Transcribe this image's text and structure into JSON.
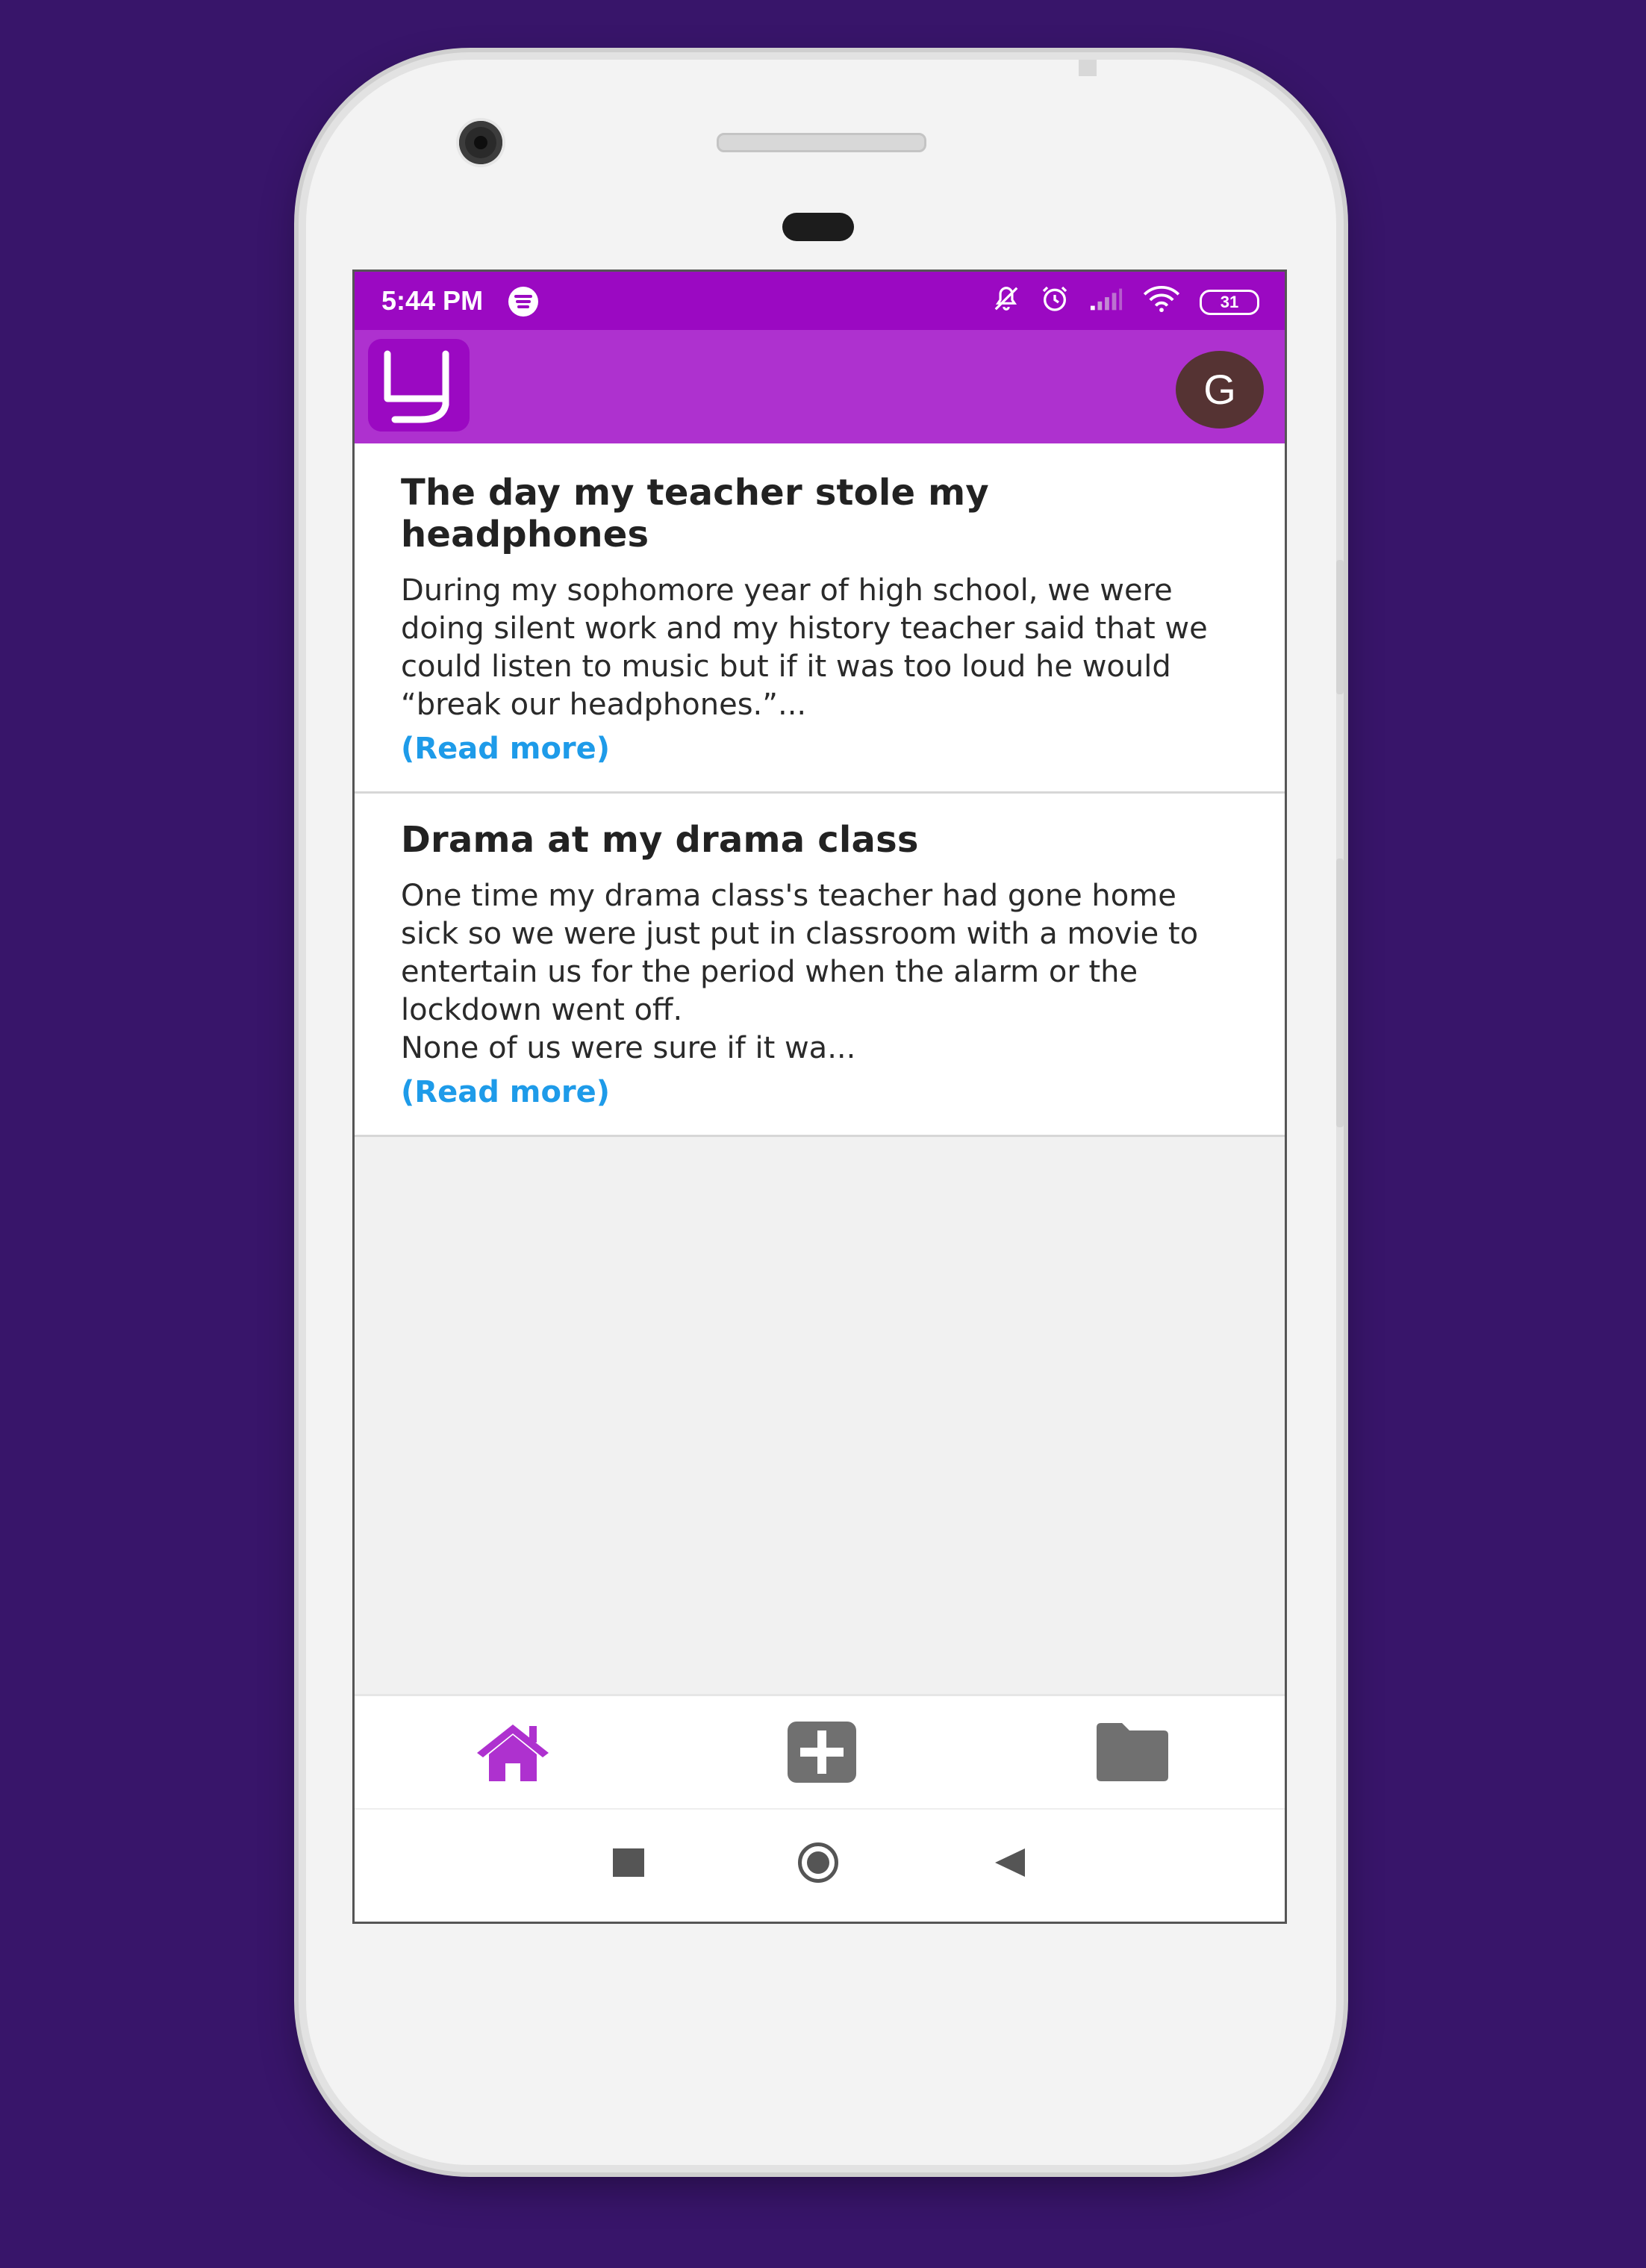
{
  "status_bar": {
    "time": "5:44 PM",
    "battery": "31",
    "icons": [
      "spotify-icon",
      "bell-off-icon",
      "alarm-icon",
      "signal-icon",
      "wifi-icon",
      "battery-icon"
    ]
  },
  "app_bar": {
    "logo_icon": "app-logo-icon",
    "avatar_initial": "G",
    "accent_color": "#ae31cf",
    "status_color": "#9b09c2"
  },
  "posts": [
    {
      "title": "The day my teacher stole my headphones",
      "excerpt": "During my sophomore year of high school, we were doing silent work and my history teacher said that we could listen to music but if it was too loud he would “break our headphones.”...",
      "read_more": "(Read more)"
    },
    {
      "title": "Drama at my drama class",
      "excerpt": "One time my drama class's teacher had gone home sick so we were just put in classroom with a movie to entertain us for the period when the alarm or the lockdown went off.\nNone of us were sure if it wa...",
      "read_more": "(Read more)"
    }
  ],
  "bottom_nav": {
    "items": [
      "home-icon",
      "add-icon",
      "folder-icon"
    ],
    "active": "home-icon",
    "active_color": "#ae31cf",
    "inactive_color": "#707070"
  },
  "system_nav": {
    "items": [
      "recents-square-icon",
      "home-circle-icon",
      "back-triangle-icon"
    ]
  }
}
